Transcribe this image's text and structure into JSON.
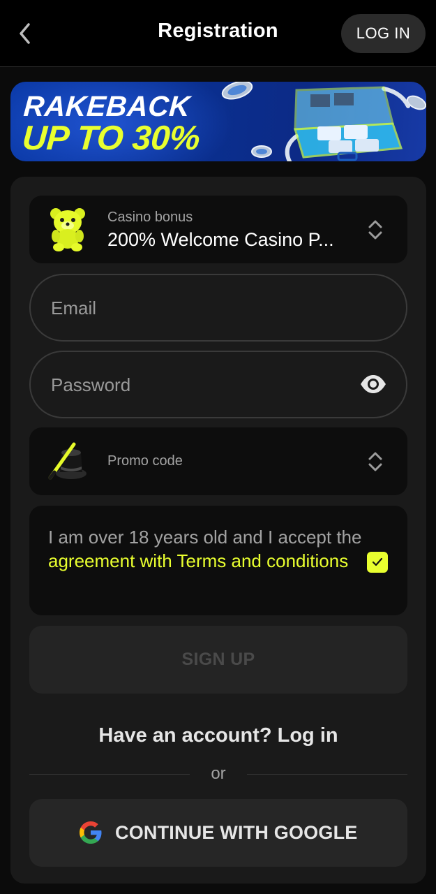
{
  "header": {
    "title": "Registration",
    "login_button": "LOG IN"
  },
  "banner": {
    "line1": "RAKEBACK",
    "line2": "UP TO 30%",
    "accent_color": "#e9ff2f"
  },
  "bonus_select": {
    "label": "Casino bonus",
    "value": "200% Welcome Casino P...",
    "icon": "gummy-bear-icon"
  },
  "email": {
    "placeholder": "Email",
    "value": ""
  },
  "password": {
    "placeholder": "Password",
    "value": ""
  },
  "promo_select": {
    "label": "Promo code",
    "icon": "magic-hat-icon"
  },
  "terms": {
    "text_lead": "I am over 18 years old and I accept the ",
    "link_text": "agreement with Terms and conditions",
    "checked": true
  },
  "signup_button": "SIGN UP",
  "login_prompt": "Have an account? Log in",
  "divider_text": "or",
  "google_button": "CONTINUE WITH GOOGLE"
}
